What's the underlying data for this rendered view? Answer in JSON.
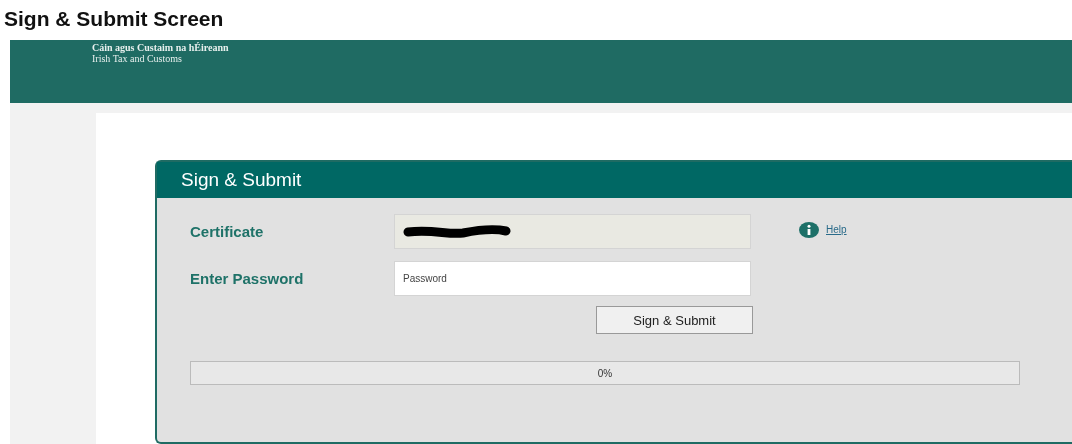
{
  "page_title": "Sign & Submit Screen",
  "banner": {
    "line_1": "Cáin agus Custaim na hÉireann",
    "line_2": "Irish Tax and Customs"
  },
  "dialog": {
    "title": "Sign & Submit",
    "certificate": {
      "label": "Certificate",
      "redacted": true
    },
    "help_link": "Help",
    "password": {
      "label": "Enter Password",
      "placeholder": "Password"
    },
    "submit_button": "Sign & Submit",
    "progress": {
      "level": 0,
      "reading": "0%"
    }
  }
}
